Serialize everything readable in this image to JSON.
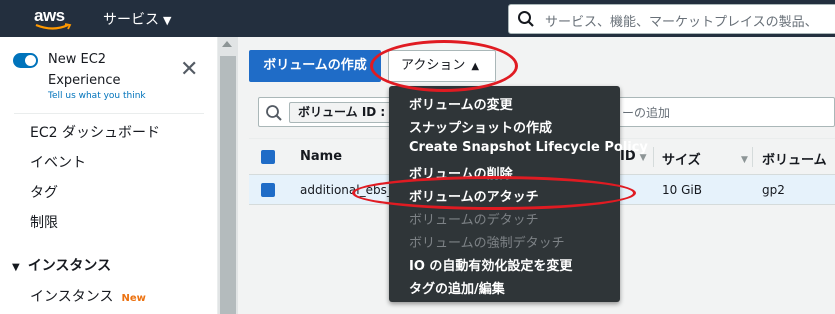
{
  "topnav": {
    "logo_text": "aws",
    "services_label": "サービス",
    "search_placeholder": "サービス、機能、マーケットプレイスの製品、"
  },
  "sidebar": {
    "new_experience_label": "New EC2 Experience",
    "tell_us_link": "Tell us what you think",
    "items": [
      {
        "label": "EC2 ダッシュボード"
      },
      {
        "label": "イベント"
      },
      {
        "label": "タグ"
      },
      {
        "label": "制限"
      }
    ],
    "section_instances": "インスタンス",
    "instances_item": "インスタンス",
    "new_badge": "New"
  },
  "toolbar": {
    "create_volume_label": "ボリュームの作成",
    "actions_label": "アクション"
  },
  "filter": {
    "token_label": "ボリューム ID :",
    "tail_text": "ーの追加"
  },
  "table": {
    "headers": {
      "name": "Name",
      "id_fragment": "ID",
      "size": "サイズ",
      "volume_type": "ボリューム"
    },
    "rows": [
      {
        "name": "additional_ebs_",
        "size": "10 GiB",
        "type": "gp2"
      }
    ]
  },
  "actions_menu": {
    "items": [
      {
        "label": "ボリュームの変更",
        "enabled": true
      },
      {
        "label": "スナップショットの作成",
        "enabled": true
      },
      {
        "label": "Create Snapshot Lifecycle Policy",
        "enabled": true
      },
      {
        "label": "ボリュームの削除",
        "enabled": true
      },
      {
        "label": "ボリュームのアタッチ",
        "enabled": true
      },
      {
        "label": "ボリュームのデタッチ",
        "enabled": false
      },
      {
        "label": "ボリュームの強制デタッチ",
        "enabled": false
      },
      {
        "label": "IO の自動有効化設定を変更",
        "enabled": true
      },
      {
        "label": "タグの追加/編集",
        "enabled": true
      }
    ]
  },
  "colors": {
    "topnav_bg": "#232f3e",
    "primary_button": "#1f6cc7",
    "menu_bg": "#2f3538",
    "annotation_red": "#e01b22",
    "new_badge": "#ec7211"
  }
}
